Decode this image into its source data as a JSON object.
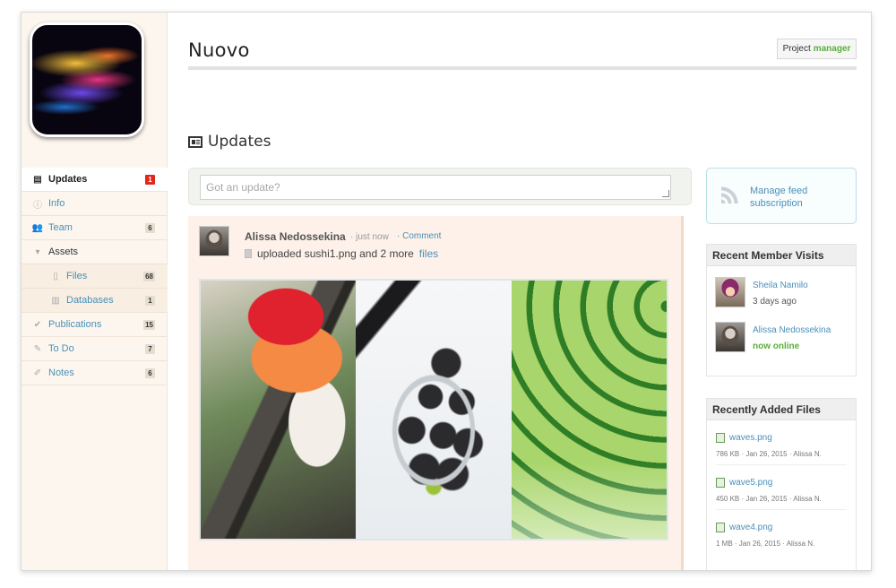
{
  "project": {
    "title": "Nuovo",
    "role_prefix": "Project",
    "role": "manager"
  },
  "sidebar": {
    "items": [
      {
        "label": "Updates",
        "icon": "newspaper-icon",
        "badge": "1"
      },
      {
        "label": "Info",
        "icon": "info-icon",
        "badge": ""
      },
      {
        "label": "Team",
        "icon": "people-icon",
        "badge": "6"
      },
      {
        "label": "Assets",
        "icon": "caret-down-icon",
        "badge": ""
      },
      {
        "label": "Files",
        "icon": "file-icon",
        "badge": "68"
      },
      {
        "label": "Databases",
        "icon": "database-icon",
        "badge": "1"
      },
      {
        "label": "Publications",
        "icon": "check-circle-icon",
        "badge": "15"
      },
      {
        "label": "To Do",
        "icon": "todo-icon",
        "badge": "7"
      },
      {
        "label": "Notes",
        "icon": "pencil-icon",
        "badge": "6"
      }
    ]
  },
  "updates": {
    "section_title": "Updates",
    "composer_placeholder": "Got an update?",
    "post": {
      "author": "Alissa Nedossekina",
      "time": "· just now",
      "comment": "· Comment",
      "activity_text": "uploaded sushi1.png and 2 more",
      "activity_link": "files"
    }
  },
  "feed": {
    "link": "Manage feed subscription"
  },
  "recent_visits": {
    "title": "Recent Member Visits",
    "members": [
      {
        "name": "Sheila Namilo",
        "status": "3 days ago"
      },
      {
        "name": "Alissa Nedossekina",
        "status": "now online"
      }
    ]
  },
  "recent_files": {
    "title": "Recently Added Files",
    "files": [
      {
        "name": "waves.png",
        "meta": "786 KB · Jan 26, 2015 · Alissa N."
      },
      {
        "name": "wave5.png",
        "meta": "450 KB · Jan 26, 2015 · Alissa N."
      },
      {
        "name": "wave4.png",
        "meta": "1 MB · Jan 26, 2015 · Alissa N."
      }
    ]
  },
  "colors": {
    "link": "#4a90b8",
    "online": "#5aae3a",
    "badge_alert": "#e1261c",
    "sidebar_bg": "#fdf6ee"
  }
}
